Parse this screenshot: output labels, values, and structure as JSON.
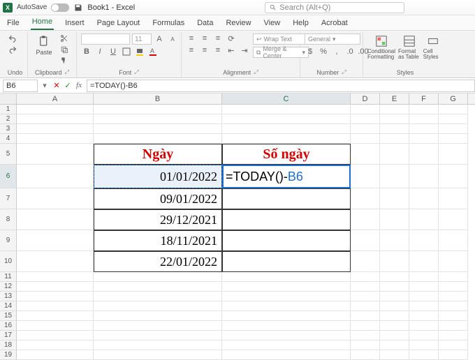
{
  "titlebar": {
    "autosave_label": "AutoSave",
    "autosave_state": "Off",
    "doc_title": "Book1 - Excel",
    "search_placeholder": "Search (Alt+Q)"
  },
  "tabs": [
    "File",
    "Home",
    "Insert",
    "Page Layout",
    "Formulas",
    "Data",
    "Review",
    "View",
    "Help",
    "Acrobat"
  ],
  "active_tab": "Home",
  "ribbon": {
    "groups": {
      "undo": {
        "label": "Undo"
      },
      "clipboard": {
        "label": "Clipboard",
        "paste": "Paste"
      },
      "font": {
        "label": "Font",
        "size_placeholder": "11"
      },
      "alignment": {
        "label": "Alignment",
        "wrap": "Wrap Text",
        "merge": "Merge & Center"
      },
      "number": {
        "label": "Number",
        "format": "General"
      },
      "styles": {
        "label": "Styles",
        "cond": "Conditional Formatting",
        "table": "Format as Table",
        "cell": "Cell Styles"
      }
    }
  },
  "namebox": "B6",
  "formula": "=TODAY()-B6",
  "columns": [
    "A",
    "B",
    "C",
    "D",
    "E",
    "F",
    "G"
  ],
  "row_count": 19,
  "active_row": "6",
  "active_col": "C",
  "table": {
    "header_row": 5,
    "headers": {
      "B": "Ngày",
      "C": "Số ngày"
    },
    "b_values": [
      "01/01/2022",
      "09/01/2022",
      "29/12/2021",
      "18/11/2021",
      "22/01/2022"
    ],
    "c6_formula_prefix": "=TODAY()-",
    "c6_formula_ref": "B6"
  }
}
